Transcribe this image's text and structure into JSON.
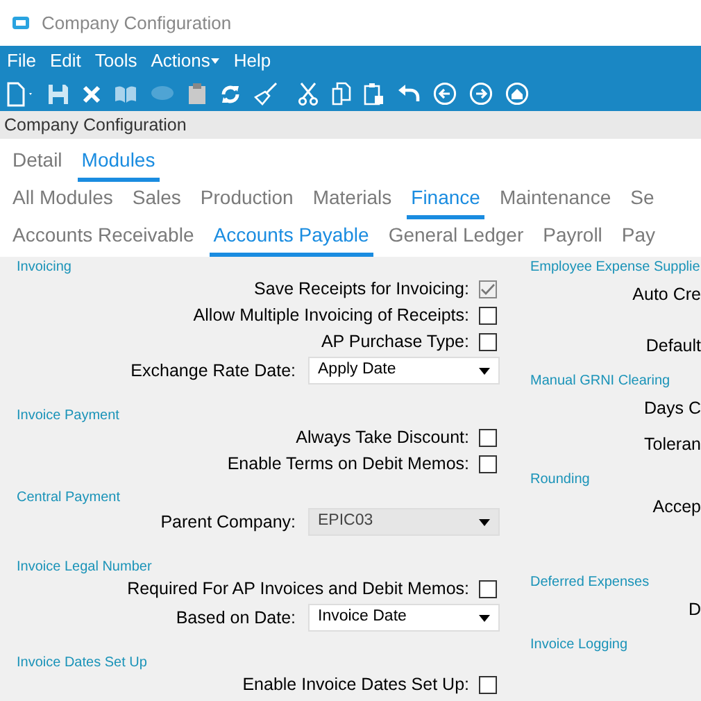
{
  "window": {
    "title": "Company Configuration"
  },
  "menu": [
    {
      "label": "File",
      "has_dropdown": false
    },
    {
      "label": "Edit",
      "has_dropdown": false
    },
    {
      "label": "Tools",
      "has_dropdown": false
    },
    {
      "label": "Actions",
      "has_dropdown": true
    },
    {
      "label": "Help",
      "has_dropdown": false
    }
  ],
  "breadcrumb": "Company Configuration",
  "tab_rows": [
    [
      {
        "label": "Detail",
        "selected": false
      },
      {
        "label": "Modules",
        "selected": true
      }
    ],
    [
      {
        "label": "All Modules",
        "selected": false
      },
      {
        "label": "Sales",
        "selected": false
      },
      {
        "label": "Production",
        "selected": false
      },
      {
        "label": "Materials",
        "selected": false
      },
      {
        "label": "Finance",
        "selected": true
      },
      {
        "label": "Maintenance",
        "selected": false
      },
      {
        "label": "Se",
        "selected": false
      }
    ],
    [
      {
        "label": "Accounts Receivable",
        "selected": false
      },
      {
        "label": "Accounts Payable",
        "selected": true
      },
      {
        "label": "General Ledger",
        "selected": false
      },
      {
        "label": "Payroll",
        "selected": false
      },
      {
        "label": "Pay",
        "selected": false
      }
    ]
  ],
  "left_sections": [
    {
      "heading": "Invoicing",
      "rows": [
        {
          "kind": "checkbox",
          "label": "Save Receipts for Invoicing:",
          "checked": true,
          "disabled": true
        },
        {
          "kind": "checkbox",
          "label": "Allow Multiple Invoicing of Receipts:",
          "checked": false,
          "disabled": false
        },
        {
          "kind": "checkbox",
          "label": "AP Purchase Type:",
          "checked": false,
          "disabled": false
        },
        {
          "kind": "combo",
          "label": "Exchange Rate Date:",
          "value": "Apply Date",
          "disabled": false
        }
      ]
    },
    {
      "heading": "Invoice Payment",
      "rows": [
        {
          "kind": "checkbox",
          "label": "Always Take Discount:",
          "checked": false,
          "disabled": false
        },
        {
          "kind": "checkbox",
          "label": "Enable Terms on Debit Memos:",
          "checked": false,
          "disabled": false
        }
      ]
    },
    {
      "heading": "Central Payment",
      "rows": [
        {
          "kind": "combo",
          "label": "Parent Company:",
          "value": "EPIC03",
          "disabled": true
        }
      ]
    },
    {
      "heading": "Invoice Legal Number",
      "rows": [
        {
          "kind": "checkbox",
          "label": "Required For AP Invoices and  Debit Memos:",
          "checked": false,
          "disabled": false
        },
        {
          "kind": "combo",
          "label": "Based on Date:",
          "value": "Invoice Date",
          "disabled": false
        }
      ]
    },
    {
      "heading": "Invoice Dates Set Up",
      "rows": [
        {
          "kind": "checkbox",
          "label": "Enable Invoice Dates Set Up:",
          "checked": false,
          "disabled": false
        }
      ]
    }
  ],
  "right_sections": [
    {
      "heading": "Employee Expense Supplie",
      "rows": [
        {
          "label": "Auto Cre"
        },
        {
          "label": "Default"
        }
      ]
    },
    {
      "heading": "Manual GRNI Clearing",
      "rows": [
        {
          "label": "Days C"
        },
        {
          "label": "Toleran"
        }
      ]
    },
    {
      "heading": "Rounding",
      "rows": [
        {
          "label": "Accep"
        }
      ]
    },
    {
      "heading": "Deferred Expenses",
      "rows": [
        {
          "label": "D"
        }
      ]
    },
    {
      "heading": "Invoice Logging"
    }
  ]
}
